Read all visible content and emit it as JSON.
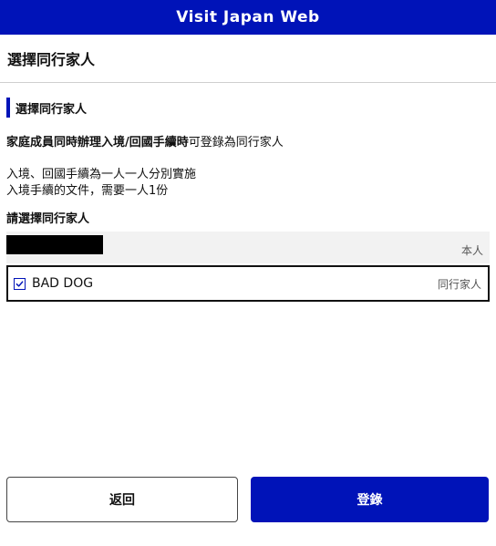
{
  "app_bar": {
    "title": "Visit Japan Web"
  },
  "header": {
    "title": "選擇同行家人"
  },
  "section": {
    "heading": "選擇同行家人"
  },
  "notice": {
    "strong_text": "家庭成員同時辦理入境/回國手續時",
    "rest_text": "可登錄為同行家人"
  },
  "info": {
    "line1": "入境、回國手續為一人一人分別實施",
    "line2": "入境手續的文件，需要一人1份"
  },
  "selection": {
    "label": "請選擇同行家人",
    "self": {
      "name_redacted": true,
      "tag": "本人"
    },
    "companion": {
      "name": "BAD DOG",
      "tag": "同行家人",
      "checked": true
    }
  },
  "buttons": {
    "back": "返回",
    "register": "登錄"
  },
  "colors": {
    "brand": "#0013b8",
    "row_background": "#f2f2f2"
  }
}
